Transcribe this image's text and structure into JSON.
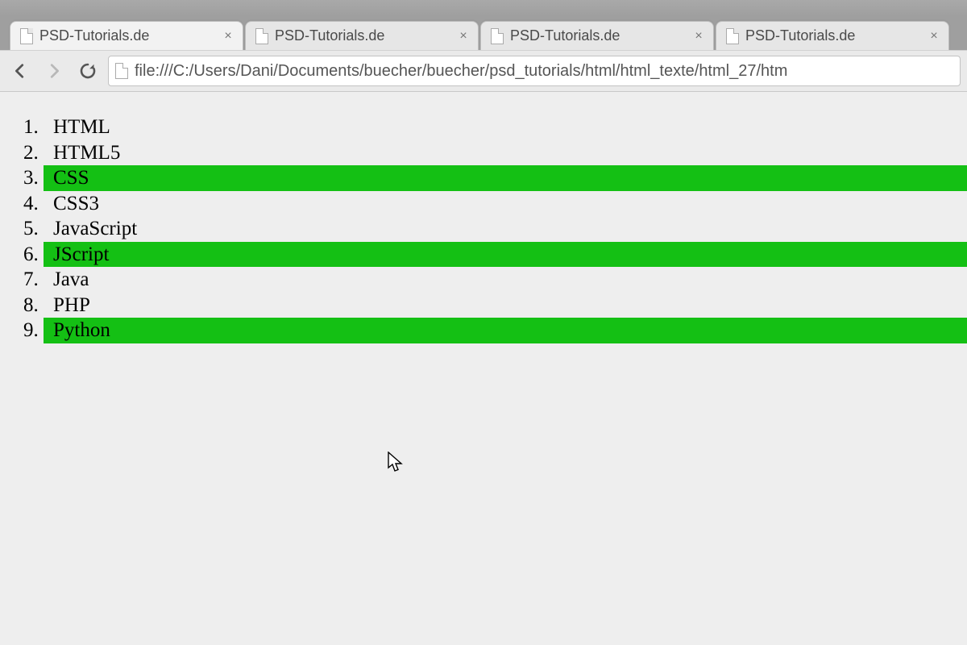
{
  "tabs": [
    {
      "title": "PSD-Tutorials.de",
      "active": true
    },
    {
      "title": "PSD-Tutorials.de",
      "active": false
    },
    {
      "title": "PSD-Tutorials.de",
      "active": false
    },
    {
      "title": "PSD-Tutorials.de",
      "active": false
    }
  ],
  "address_bar": {
    "url": "file:///C:/Users/Dani/Documents/buecher/buecher/psd_tutorials/html/html_texte/html_27/htm"
  },
  "list": {
    "items": [
      {
        "label": "HTML",
        "highlight": false
      },
      {
        "label": "HTML5",
        "highlight": false
      },
      {
        "label": "CSS",
        "highlight": true
      },
      {
        "label": "CSS3",
        "highlight": false
      },
      {
        "label": "JavaScript",
        "highlight": false
      },
      {
        "label": "JScript",
        "highlight": true
      },
      {
        "label": "Java",
        "highlight": false
      },
      {
        "label": "PHP",
        "highlight": false
      },
      {
        "label": "Python",
        "highlight": true
      }
    ]
  },
  "colors": {
    "highlight": "#14c014"
  }
}
